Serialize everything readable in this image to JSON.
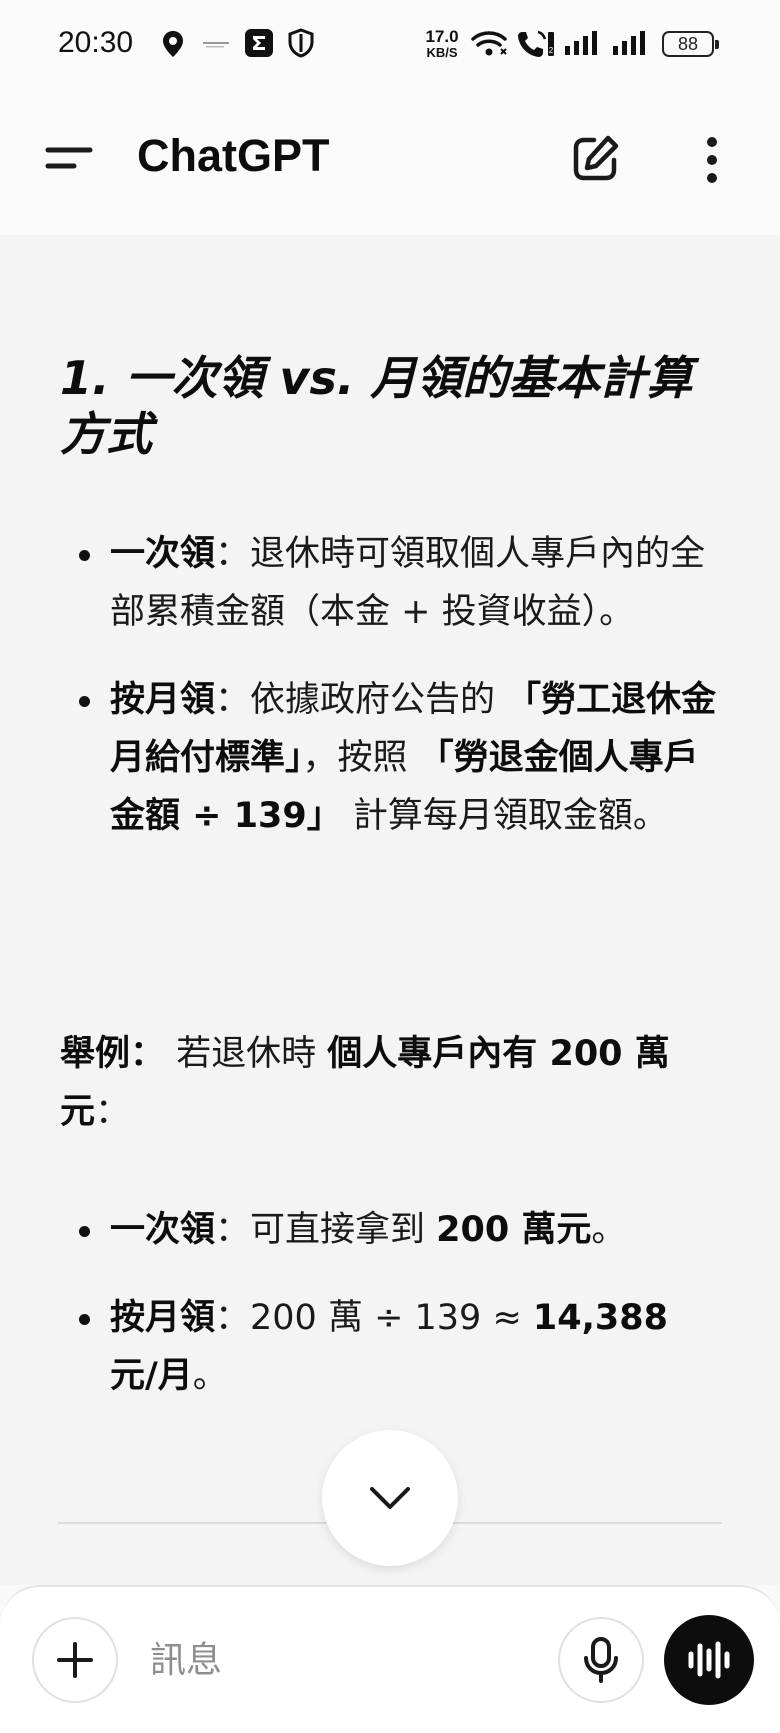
{
  "status_bar": {
    "time": "20:30",
    "network_speed_value": "17.0",
    "network_speed_unit": "KB/S",
    "battery": "88",
    "icons": [
      "location-icon",
      "realme-icon",
      "app-notification-icon",
      "shield-icon",
      "wifi-icon",
      "call-icon",
      "signal-icon",
      "signal-icon-2",
      "battery-icon"
    ]
  },
  "app_bar": {
    "title": "ChatGPT",
    "icons": [
      "menu-icon",
      "new-chat-icon",
      "more-vertical-icon"
    ]
  },
  "content": {
    "heading": "1. 一次領 vs. 月領的基本計算方式",
    "bullets_a": [
      {
        "label": "一次領",
        "text": "：退休時可領取個人專戶內的全部累積金額（本金 + 投資收益）。"
      },
      {
        "label": "按月領",
        "text_1": "：依據政府公告的 ",
        "strong_1": "「勞工退休金月給付標準」",
        "text_2": "，按照 ",
        "strong_2": "「勞退金個人專戶金額 ÷ 139」",
        "text_3": " 計算每月領取金額。"
      }
    ],
    "example": {
      "label": "舉例：",
      "text_1": " 若退休時 ",
      "strong": "個人專戶內有 200 萬元",
      "text_2": "："
    },
    "bullets_b": [
      {
        "label": "一次領",
        "text_1": "：可直接拿到 ",
        "strong": "200 萬元",
        "text_2": "。"
      },
      {
        "label": "按月領",
        "text_1": "：200 萬 ÷ 139 ≈ ",
        "strong": "14,388 元/月",
        "text_2": "。"
      }
    ]
  },
  "composer": {
    "placeholder": "訊息",
    "icons": [
      "plus-icon",
      "microphone-icon",
      "voice-waveform-icon",
      "chevron-down-icon"
    ]
  },
  "colors": {
    "background": "#f4f4f4",
    "text": "#0d0d0d",
    "voice_button": "#0d0d0d"
  }
}
